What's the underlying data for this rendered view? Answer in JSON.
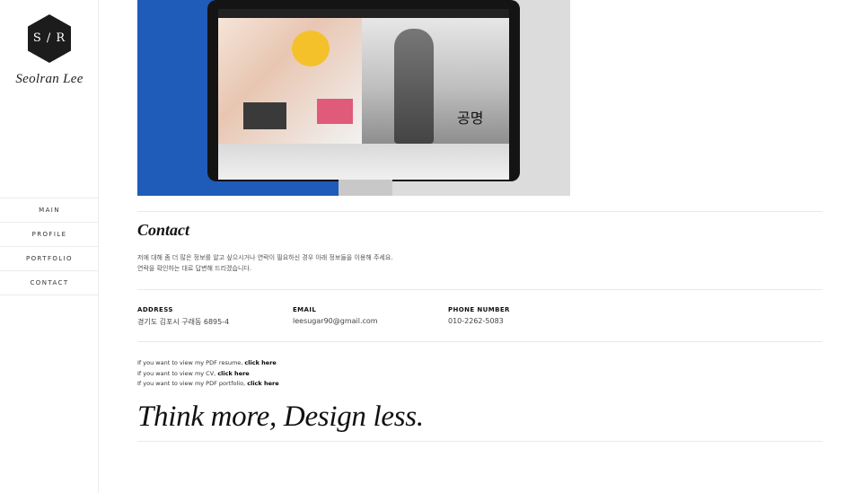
{
  "sidebar": {
    "logo_text": "S / R",
    "brand_name": "Seolran Lee",
    "nav": [
      {
        "label": "MAIN"
      },
      {
        "label": "PROFILE"
      },
      {
        "label": "PORTFOLIO"
      },
      {
        "label": "CONTACT"
      }
    ]
  },
  "hero": {
    "screen_title": "공명"
  },
  "contact": {
    "title": "Contact",
    "intro_line1": "저에 대해 좀 더 많은 정보를 알고 싶으시거나 연락이 필요하신 경우 아래 정보들을 이용해 주세요.",
    "intro_line2": "연락을 확인하는 대로 답변해 드리겠습니다.",
    "info": [
      {
        "label": "ADDRESS",
        "value": "경기도 김포시 구래동 6895-4"
      },
      {
        "label": "EMAIL",
        "value": "leesugar90@gmail.com"
      },
      {
        "label": "PHONE NUMBER",
        "value": "010-2262-5083"
      }
    ],
    "links": [
      {
        "text": "If you want to view my PDF resume, ",
        "link": "click here"
      },
      {
        "text": "If you want to view my CV, ",
        "link": "click here"
      },
      {
        "text": "If you want to view my PDF portfolio, ",
        "link": "click here"
      }
    ],
    "tagline": "Think more, Design less."
  },
  "colors": {
    "accent_blue": "#1f5bb8",
    "logo_dark": "#1c1c1c",
    "divider": "#e9e9e9"
  }
}
